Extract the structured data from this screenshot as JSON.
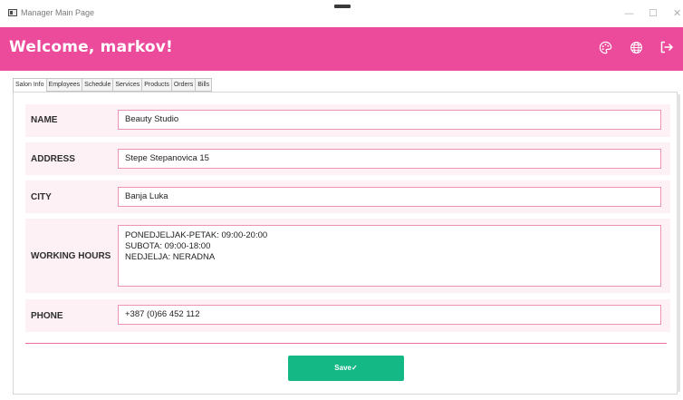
{
  "window": {
    "title": "Manager Main Page",
    "minimize_glyph": "—",
    "maximize_glyph": "☐",
    "close_glyph": "✕"
  },
  "header": {
    "welcome": "Welcome, markov!",
    "background": "#ec4a9a",
    "icons": [
      "palette-icon",
      "globe-icon",
      "logout-icon"
    ]
  },
  "tabs": [
    {
      "label": "Salon Info",
      "active": true
    },
    {
      "label": "Employees",
      "active": false
    },
    {
      "label": "Schedule",
      "active": false
    },
    {
      "label": "Services",
      "active": false
    },
    {
      "label": "Products",
      "active": false
    },
    {
      "label": "Orders",
      "active": false
    },
    {
      "label": "Bills",
      "active": false
    }
  ],
  "form": {
    "name_label": "NAME",
    "name_value": "Beauty Studio",
    "address_label": "ADDRESS",
    "address_value": "Stepe Stepanovica 15",
    "city_label": "CITY",
    "city_value": "Banja Luka",
    "hours_label": "WORKING HOURS",
    "hours_value": "PONEDJELJAK-PETAK: 09:00-20:00\nSUBOTA: 09:00-18:00\nNEDJELJA: NERADNA",
    "phone_label": "PHONE",
    "phone_value": "+387 (0)66 452 112"
  },
  "save_label": "Save✓",
  "colors": {
    "accent": "#ec4a9a",
    "field_border": "#ec93b7",
    "row_background": "#fdf1f5",
    "save_button": "#14b885"
  }
}
